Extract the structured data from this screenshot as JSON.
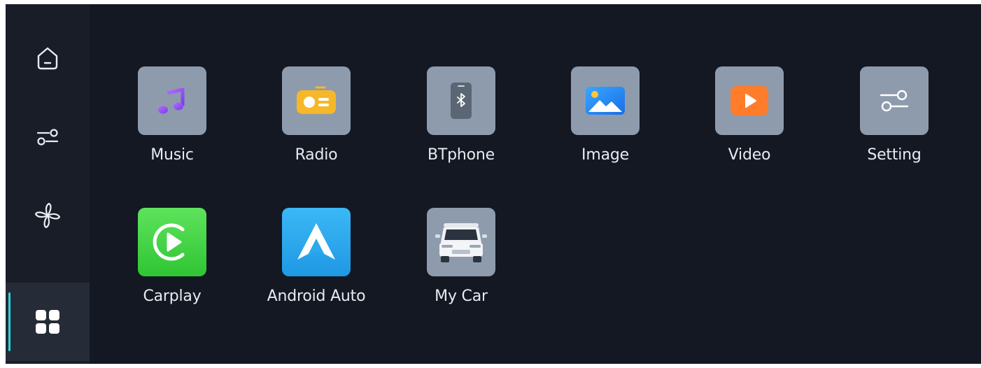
{
  "sidebar": {
    "items": [
      {
        "name": "home",
        "icon": "home-icon"
      },
      {
        "name": "controls",
        "icon": "sliders-icon"
      },
      {
        "name": "fan",
        "icon": "fan-icon"
      },
      {
        "name": "apps",
        "icon": "apps-grid-icon",
        "active": true
      }
    ],
    "accent": "#2ad7e0"
  },
  "apps": [
    {
      "label": "Music",
      "icon": "music-icon"
    },
    {
      "label": "Radio",
      "icon": "radio-icon"
    },
    {
      "label": "BTphone",
      "icon": "bluetooth-phone-icon"
    },
    {
      "label": "Image",
      "icon": "image-icon"
    },
    {
      "label": "Video",
      "icon": "video-play-icon"
    },
    {
      "label": "Setting",
      "icon": "settings-sliders-icon"
    },
    {
      "label": "Carplay",
      "icon": "carplay-icon"
    },
    {
      "label": "Android Auto",
      "icon": "android-auto-icon"
    },
    {
      "label": "My Car",
      "icon": "car-icon"
    }
  ],
  "colors": {
    "background": "#131823",
    "sidebar": "#181d28",
    "tile": "#8e9bad",
    "carplay": "#3fd34a",
    "android_auto": "#2aa9ec"
  }
}
